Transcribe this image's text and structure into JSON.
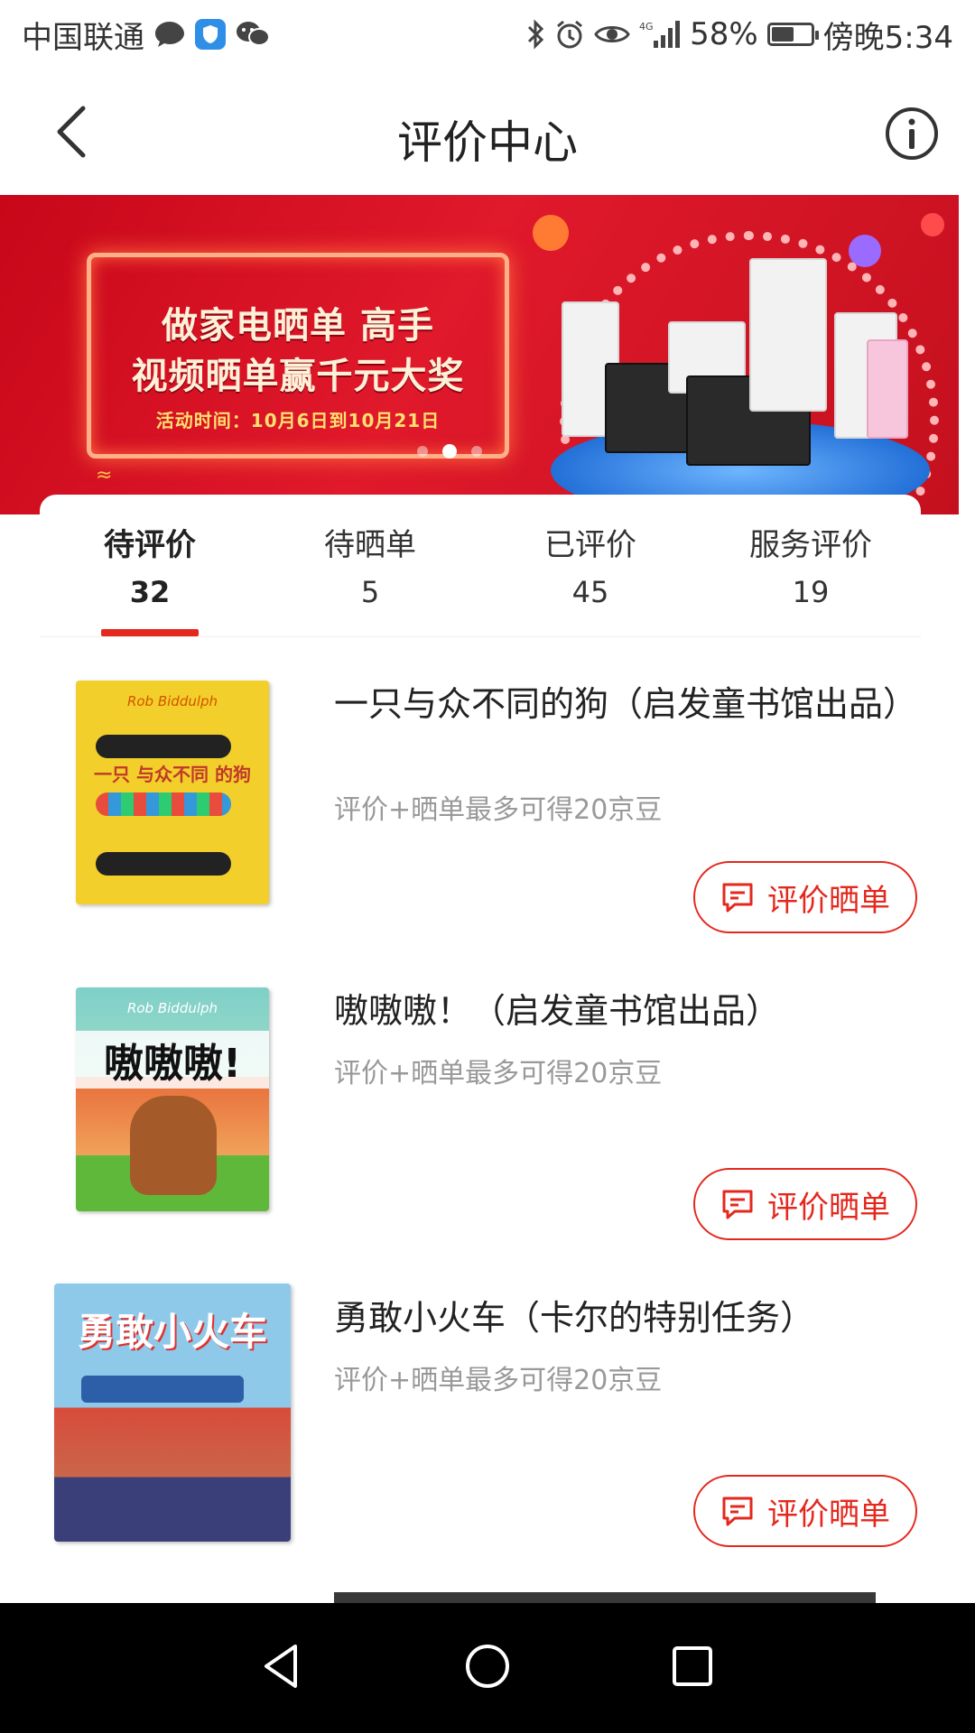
{
  "status_bar": {
    "carrier": "中国联通",
    "battery": "58%",
    "time": "傍晚5:34",
    "icons": [
      "message-icon",
      "shield-icon",
      "wechat-icon",
      "bluetooth-icon",
      "alarm-icon",
      "eye-icon",
      "signal-4g-icon",
      "battery-icon"
    ]
  },
  "nav": {
    "title": "评价中心",
    "back_icon": "back-arrow-icon",
    "info_icon": "info-icon"
  },
  "banner": {
    "line1": "做家电晒单 高手",
    "line2": "视频晒单赢千元大奖",
    "date_line": "活动时间：10月6日到10月21日",
    "active_slide": 2,
    "slide_count": 3,
    "colors": {
      "bg": "#d8121f",
      "accent": "#ffe070"
    }
  },
  "tabs": [
    {
      "label": "待评价",
      "count": "32",
      "active": true
    },
    {
      "label": "待晒单",
      "count": "5",
      "active": false
    },
    {
      "label": "已评价",
      "count": "45",
      "active": false
    },
    {
      "label": "服务评价",
      "count": "19",
      "active": false
    }
  ],
  "items": [
    {
      "title": "一只与众不同的狗（启发童书馆出品）",
      "tip": "评价+晒单最多可得20京豆",
      "button": "评价晒单",
      "cover": {
        "author": "Rob Biddulph",
        "text": "一只 与众不同 的狗"
      }
    },
    {
      "title": "嗷嗷嗷！（启发童书馆出品）",
      "tip": "评价+晒单最多可得20京豆",
      "button": "评价晒单",
      "cover": {
        "author": "Rob Biddulph",
        "text": "嗷嗷嗷!"
      }
    },
    {
      "title": "勇敢小火车（卡尔的特别任务）",
      "tip": "评价+晒单最多可得20京豆",
      "button": "评价晒单",
      "cover": {
        "text": "勇敢小火车"
      }
    }
  ],
  "theme": {
    "accent": "#e4281e",
    "muted_text": "#999999"
  },
  "system_nav": [
    "back-triangle-icon",
    "home-circle-icon",
    "recents-square-icon"
  ]
}
